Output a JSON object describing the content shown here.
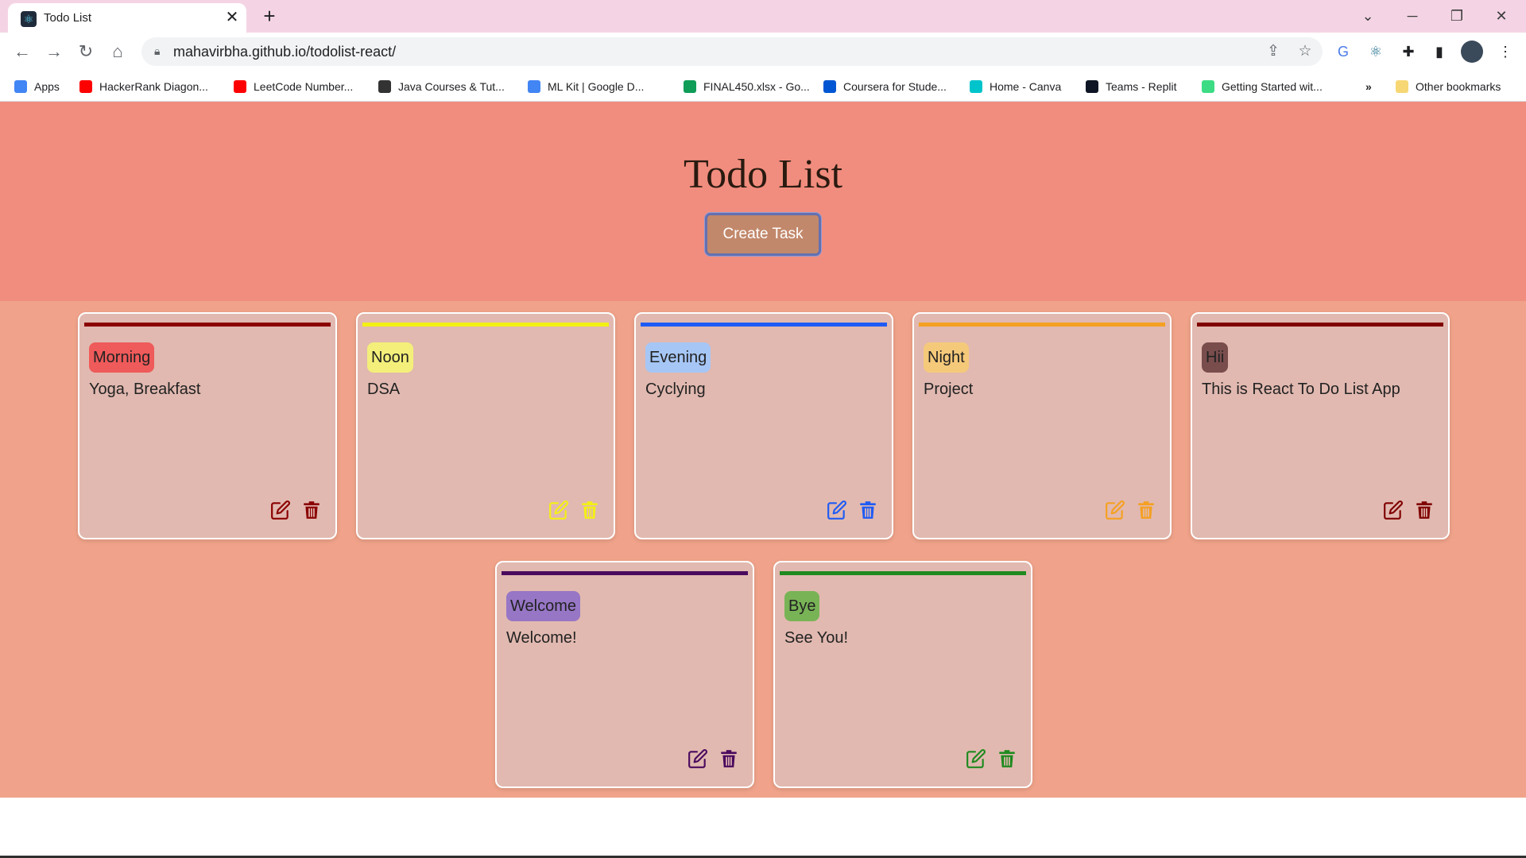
{
  "browser": {
    "tab_title": "Todo List",
    "url": "mahavirbha.github.io/todolist-react/",
    "bookmarks": [
      {
        "label": "Apps",
        "icon": "apps-grid-icon",
        "color": "#4285f4"
      },
      {
        "label": "HackerRank Diagon...",
        "icon": "youtube-icon",
        "color": "#ff0000"
      },
      {
        "label": "LeetCode Number...",
        "icon": "youtube-icon",
        "color": "#ff0000"
      },
      {
        "label": "Java Courses & Tut...",
        "icon": "site-icon",
        "color": "#333333"
      },
      {
        "label": "ML Kit | Google D...",
        "icon": "code-icon",
        "color": "#4285f4"
      },
      {
        "label": "FINAL450.xlsx - Go...",
        "icon": "google-drive-icon",
        "color": "#0f9d58"
      },
      {
        "label": "Coursera for Stude...",
        "icon": "coursera-icon",
        "color": "#0056d2"
      },
      {
        "label": "Home - Canva",
        "icon": "canva-icon",
        "color": "#00c4cc"
      },
      {
        "label": "Teams - Replit",
        "icon": "replit-icon",
        "color": "#0e1525"
      },
      {
        "label": "Getting Started wit...",
        "icon": "android-icon",
        "color": "#3ddc84"
      }
    ],
    "more_bookmarks": "»",
    "other_bookmarks": "Other bookmarks"
  },
  "app": {
    "title": "Todo List",
    "create_button": "Create Task"
  },
  "tasks": [
    {
      "tag": "Morning",
      "description": "Yoga, Breakfast",
      "accent": "#8b0000",
      "tag_bg": "#ef5a5a"
    },
    {
      "tag": "Noon",
      "description": "DSA",
      "accent": "#f3f014",
      "tag_bg": "#f3ef7a"
    },
    {
      "tag": "Evening",
      "description": "Cyclying",
      "accent": "#1e5bf5",
      "tag_bg": "#a6c6f5"
    },
    {
      "tag": "Night",
      "description": "Project",
      "accent": "#f5a020",
      "tag_bg": "#f5c97a"
    },
    {
      "tag": "Hii",
      "description": "This is React To Do List App",
      "accent": "#800000",
      "tag_bg": "#7a4d4d"
    },
    {
      "tag": "Welcome",
      "description": "Welcome!",
      "accent": "#4b0a5e",
      "tag_bg": "#9776c6"
    },
    {
      "tag": "Bye",
      "description": "See You!",
      "accent": "#1f8a1f",
      "tag_bg": "#78b356"
    }
  ]
}
